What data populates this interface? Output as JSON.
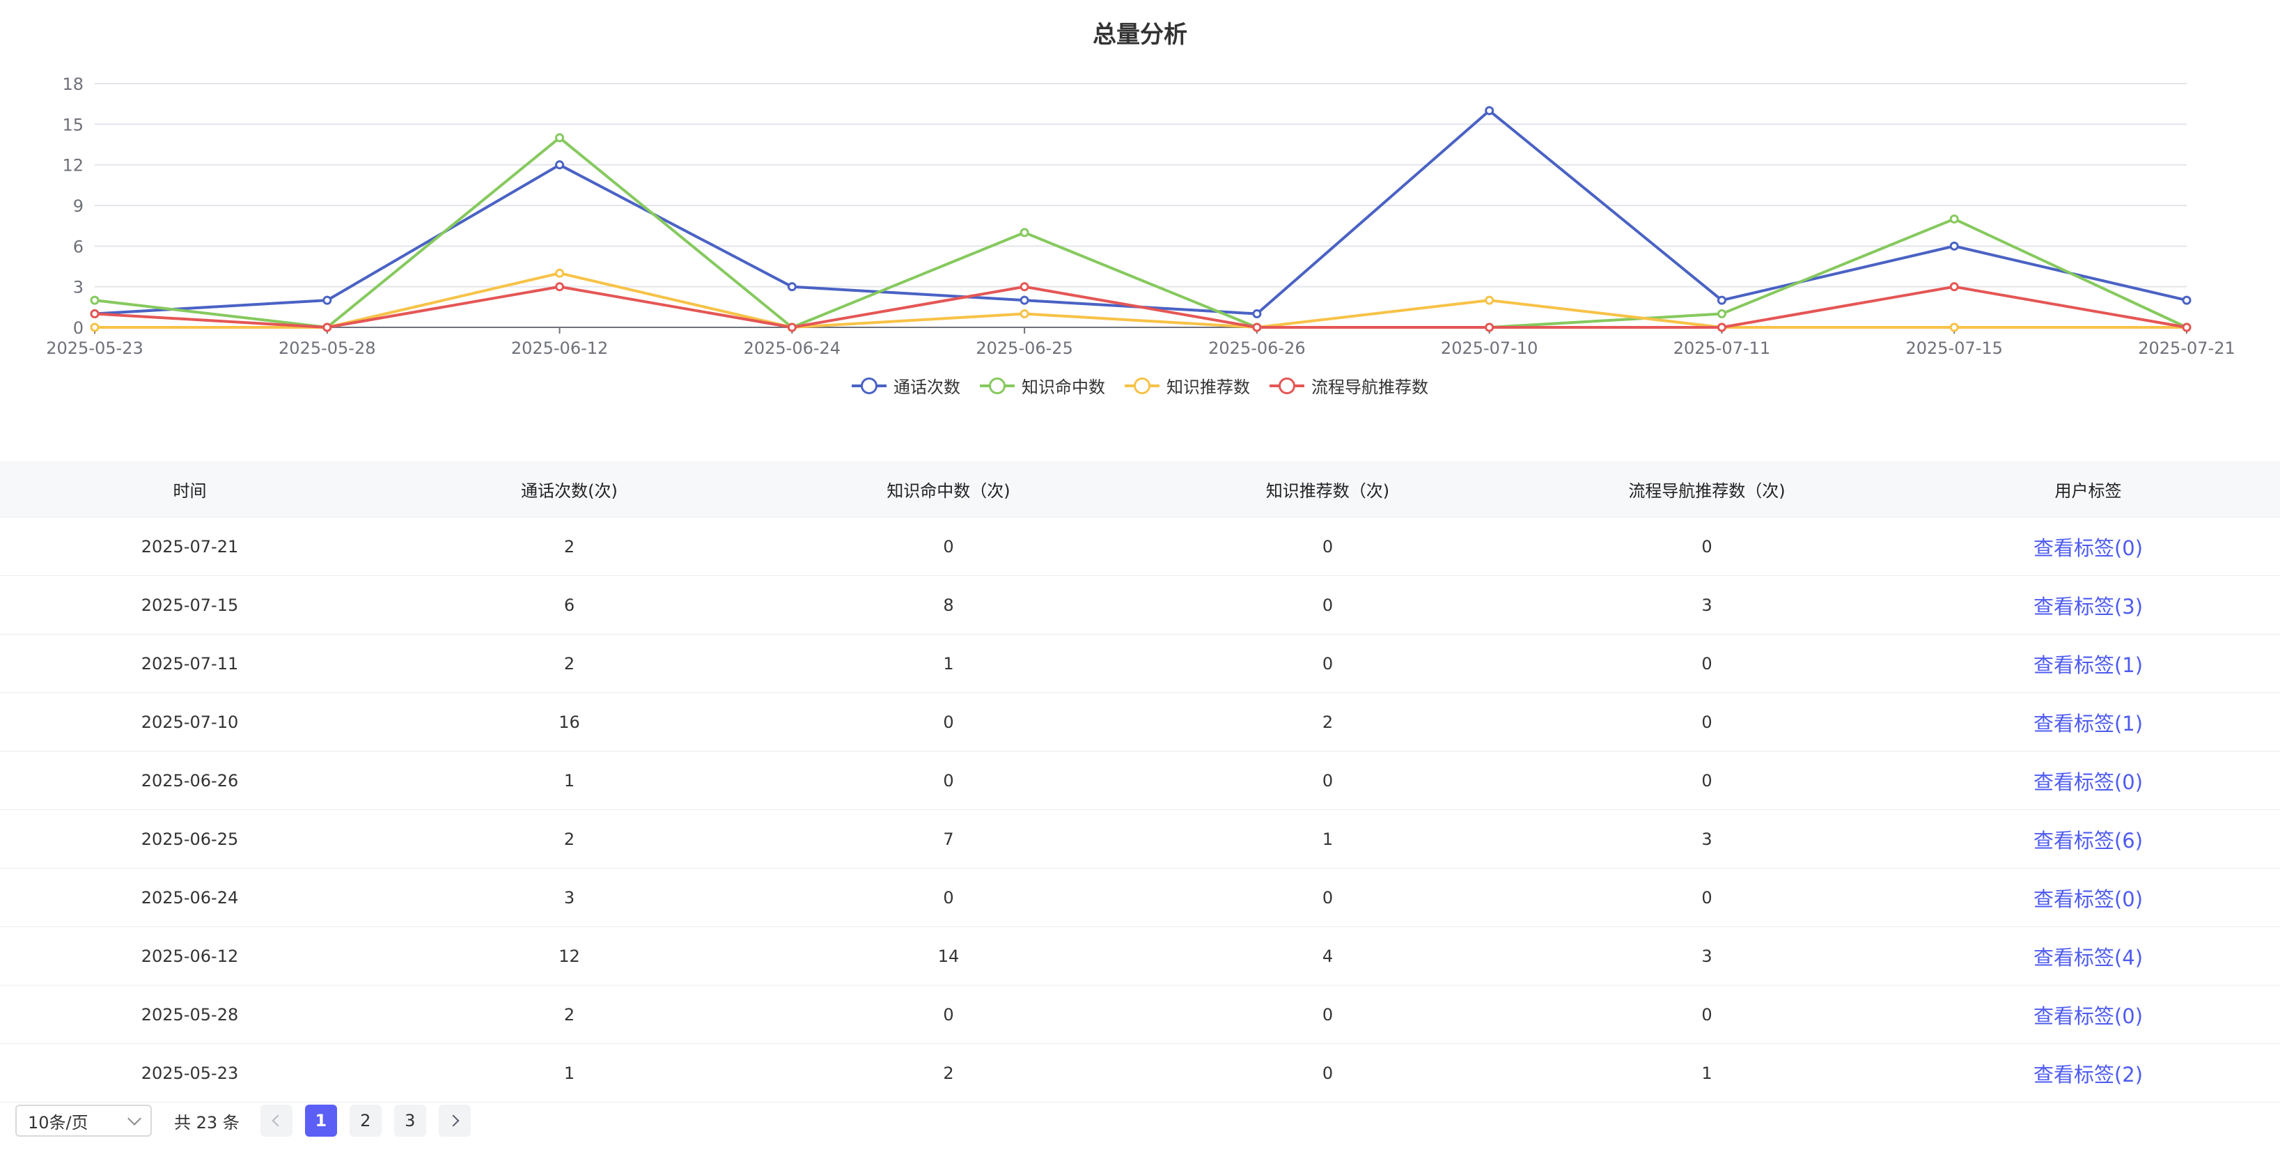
{
  "chart_data": {
    "type": "line",
    "title": "总量分析",
    "categories": [
      "2025-05-23",
      "2025-05-28",
      "2025-06-12",
      "2025-06-24",
      "2025-06-25",
      "2025-06-26",
      "2025-07-10",
      "2025-07-11",
      "2025-07-15",
      "2025-07-21"
    ],
    "ylim": [
      0,
      18
    ],
    "yticks": [
      0,
      3,
      6,
      9,
      12,
      15,
      18
    ],
    "grid": true,
    "legend_position": "bottom-center",
    "series": [
      {
        "name": "通话次数",
        "color": "#4a62c4",
        "values": [
          1,
          2,
          12,
          3,
          2,
          1,
          16,
          2,
          6,
          2
        ]
      },
      {
        "name": "知识命中数",
        "color": "#86c95e",
        "values": [
          2,
          0,
          14,
          0,
          7,
          0,
          0,
          1,
          8,
          0
        ]
      },
      {
        "name": "知识推荐数",
        "color": "#f7c247",
        "values": [
          0,
          0,
          4,
          0,
          1,
          0,
          2,
          0,
          0,
          0
        ]
      },
      {
        "name": "流程导航推荐数",
        "color": "#e45655",
        "values": [
          1,
          0,
          3,
          0,
          3,
          0,
          0,
          0,
          3,
          0
        ]
      }
    ]
  },
  "table": {
    "headers": [
      "时间",
      "通话次数(次)",
      "知识命中数（次)",
      "知识推荐数（次)",
      "流程导航推荐数（次)",
      "用户标签"
    ],
    "rows": [
      [
        "2025-07-21",
        "2",
        "0",
        "0",
        "0",
        "查看标签(0)"
      ],
      [
        "2025-07-15",
        "6",
        "8",
        "0",
        "3",
        "查看标签(3)"
      ],
      [
        "2025-07-11",
        "2",
        "1",
        "0",
        "0",
        "查看标签(1)"
      ],
      [
        "2025-07-10",
        "16",
        "0",
        "2",
        "0",
        "查看标签(1)"
      ],
      [
        "2025-06-26",
        "1",
        "0",
        "0",
        "0",
        "查看标签(0)"
      ],
      [
        "2025-06-25",
        "2",
        "7",
        "1",
        "3",
        "查看标签(6)"
      ],
      [
        "2025-06-24",
        "3",
        "0",
        "0",
        "0",
        "查看标签(0)"
      ],
      [
        "2025-06-12",
        "12",
        "14",
        "4",
        "3",
        "查看标签(4)"
      ],
      [
        "2025-05-28",
        "2",
        "0",
        "0",
        "0",
        "查看标签(0)"
      ],
      [
        "2025-05-23",
        "1",
        "2",
        "0",
        "1",
        "查看标签(2)"
      ]
    ]
  },
  "pagination": {
    "page_size": "10条/页",
    "total": "共 23 条",
    "pages": [
      "1",
      "2",
      "3"
    ],
    "current_page": "1"
  },
  "colors": {
    "link": "#4e5bf0",
    "active_page": "#5b5ff5",
    "header_bg": "#f7f8fa"
  }
}
